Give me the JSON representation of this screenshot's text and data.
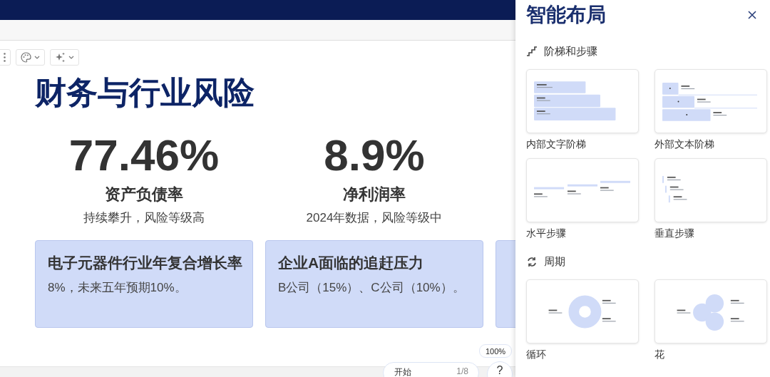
{
  "toolbar": {
    "buttons": [
      {
        "kind": "more"
      },
      {
        "kind": "theme"
      },
      {
        "kind": "ai"
      }
    ]
  },
  "slide": {
    "title": "财务与行业风险",
    "stats": [
      {
        "value": "77.46%",
        "label": "资产负债率",
        "note": "持续攀升，风险等级高"
      },
      {
        "value": "8.9%",
        "label": "净利润率",
        "note": "2024年数据，风险等级中"
      }
    ],
    "cards": [
      {
        "title": "电子元器件行业年复合增长率",
        "body_lines": [
          "8%，未来五年预期10%。"
        ]
      },
      {
        "title": "企业A面临的追赶压力",
        "body_lines": [
          "B公司（15%）、C公司（10%）。"
        ]
      },
      {
        "kind": "clipped"
      }
    ]
  },
  "zoom": "100%",
  "player": {
    "label": "开始",
    "page": "1/8"
  },
  "help_button": "?",
  "panel": {
    "title": "智能布局",
    "sections": [
      {
        "title": "阶梯和步骤",
        "layouts": [
          {
            "label": "内部文字阶梯",
            "kind": "inner-stairs"
          },
          {
            "label": "外部文本阶梯",
            "kind": "outer-stairs"
          },
          {
            "label": "水平步骤",
            "kind": "horizontal-steps"
          },
          {
            "label": "垂直步骤",
            "kind": "vertical-steps"
          }
        ]
      },
      {
        "title": "周期",
        "layouts": [
          {
            "label": "循环",
            "kind": "cycle"
          },
          {
            "label": "花",
            "kind": "flower"
          }
        ]
      }
    ]
  }
}
